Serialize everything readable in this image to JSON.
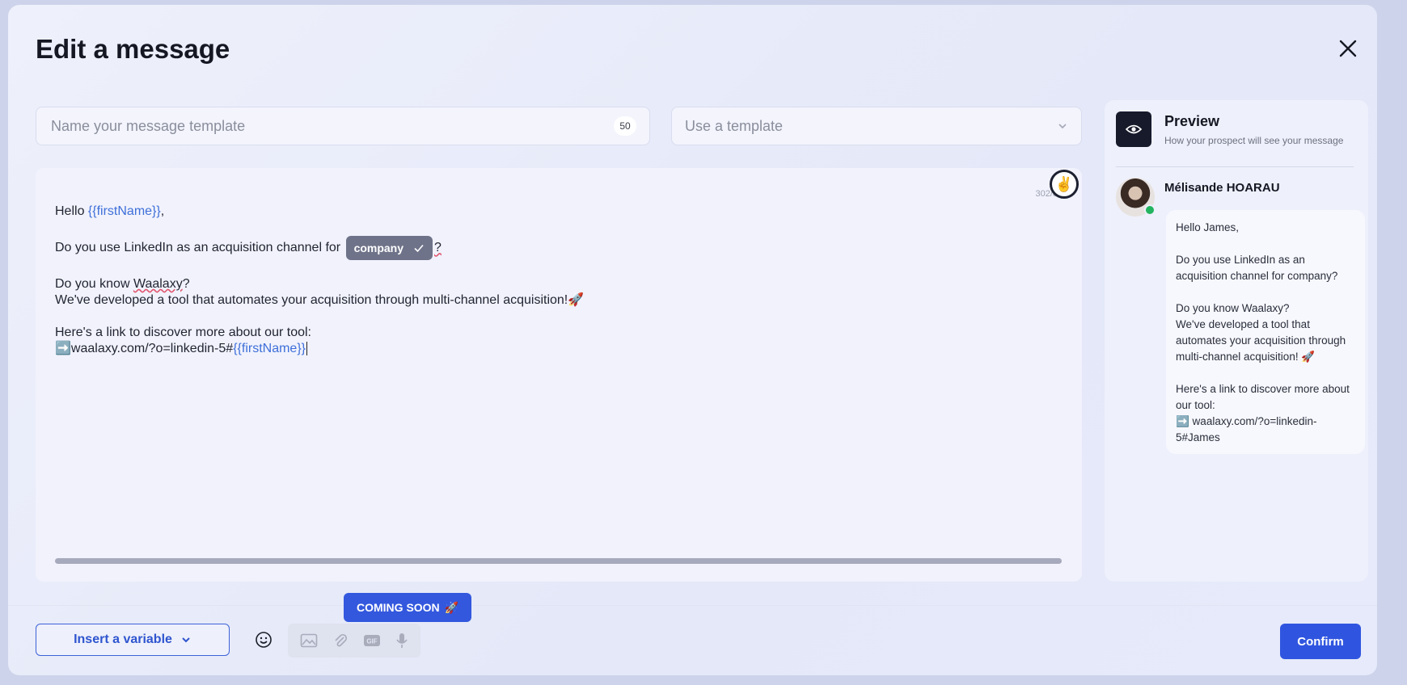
{
  "modal": {
    "title": "Edit a message"
  },
  "name_input": {
    "placeholder": "Name your message template",
    "counter": "50"
  },
  "template_select": {
    "placeholder": "Use a template"
  },
  "editor": {
    "counter": "302/8",
    "hand_emoji": "✌️",
    "lines": {
      "hello": "Hello ",
      "hello_var": "{{firstName}}",
      "hello_end": ",",
      "q1_start": "Do you use LinkedIn as an acquisition channel for ",
      "q1_chip": "company",
      "q1_end": "?",
      "q2_start": "Do you know ",
      "q2_word": "Waalaxy",
      "q2_end": "?",
      "q3": "We've developed a tool that automates your acquisition through multi-channel acquisition!",
      "q3_emoji": "🚀",
      "q4": "Here's a link to discover more about our tool:",
      "link_arrow": "➡️",
      "link_text": "waalaxy.com/?o=linkedin-5#",
      "link_var": "{{firstName}}"
    }
  },
  "preview": {
    "title": "Preview",
    "subtitle": "How your prospect will see your message",
    "sender": "Mélisande HOARAU",
    "message": {
      "l1": "Hello James,",
      "l2": "Do you use LinkedIn as an acquisition channel for company?",
      "l3": "Do you know Waalaxy?",
      "l4": "We've developed a tool that automates your acquisition through multi-channel acquisition! 🚀",
      "l5": "Here's a link to discover more about our tool:",
      "l6": "➡️ waalaxy.com/?o=linkedin-5#James"
    }
  },
  "footer": {
    "insert_variable": "Insert a variable",
    "coming_soon": "COMING SOON",
    "coming_soon_emoji": "🚀",
    "confirm": "Confirm"
  },
  "colors": {
    "accent": "#2f55e0",
    "variable": "#3e6fd9",
    "chip": "#6f7389"
  }
}
